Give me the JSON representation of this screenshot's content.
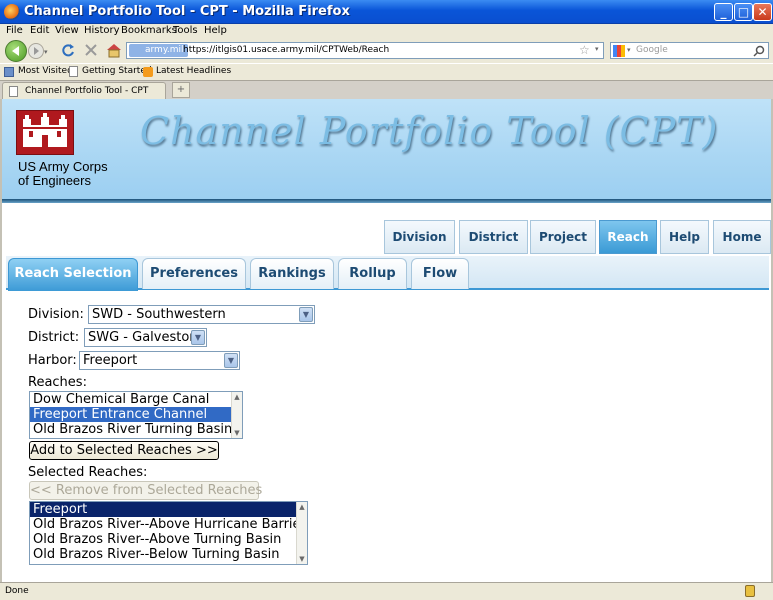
{
  "window": {
    "title": "Channel Portfolio Tool - CPT - Mozilla Firefox",
    "controls": [
      "_",
      "□",
      "✕"
    ]
  },
  "menu": [
    "File",
    "Edit",
    "View",
    "History",
    "Bookmarks",
    "Tools",
    "Help"
  ],
  "navbar": {
    "site_badge": "army.mil",
    "url": "https://itlgis01.usace.army.mil/CPTWeb/Reach",
    "search_placeholder": "Google"
  },
  "bookmarks": [
    "Most Visited",
    "Getting Started",
    "Latest Headlines"
  ],
  "browser_tab": {
    "title": "Channel Portfolio Tool - CPT",
    "new_tab": "+"
  },
  "banner": {
    "title": "Channel Portfolio Tool (CPT)",
    "org_line1": "US Army Corps",
    "org_line2": "of Engineers"
  },
  "top_nav": {
    "items": [
      "Division",
      "District",
      "Project",
      "Reach",
      "Help",
      "Home"
    ],
    "active": "Reach"
  },
  "page_tabs": {
    "items": [
      "Reach Selection",
      "Preferences",
      "Rankings",
      "Rollup",
      "Flow"
    ],
    "active": "Reach Selection"
  },
  "form": {
    "division_label": "Division:",
    "division_value": "SWD - Southwestern",
    "district_label": "District:",
    "district_value": "SWG - Galveston",
    "harbor_label": "Harbor:",
    "harbor_value": "Freeport",
    "reaches_label": "Reaches:",
    "reaches": [
      "Dow Chemical Barge Canal",
      "Freeport Entrance Channel",
      "Old Brazos River Turning Basin"
    ],
    "reaches_selected": "Freeport Entrance Channel",
    "add_button": "Add to Selected Reaches >>",
    "selected_label": "Selected Reaches:",
    "remove_button": "<< Remove from Selected Reaches",
    "selected_reaches": [
      "Freeport",
      "Old Brazos River--Above Hurricane Barrier",
      "Old Brazos River--Above Turning Basin",
      "Old Brazos River--Below Turning Basin"
    ]
  },
  "status": {
    "text": "Done"
  }
}
